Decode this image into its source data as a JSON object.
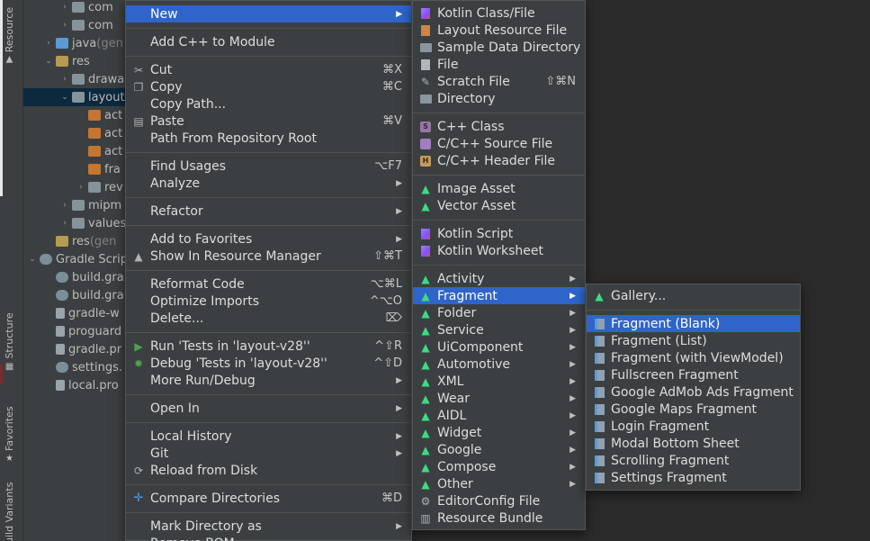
{
  "tool_stripe": {
    "resource_tab": "Resource",
    "structure_tab": "Structure",
    "favorites_tab": "Favorites",
    "build_variants_tab": "uild Variants"
  },
  "project_tree": {
    "rows": [
      {
        "indent": 1,
        "arrow": "›",
        "icon": "folder",
        "text": "com",
        "suffix": ""
      },
      {
        "indent": 1,
        "arrow": "›",
        "icon": "folder",
        "text": "com",
        "suffix": ""
      },
      {
        "indent": 0,
        "arrow": "›",
        "icon": "java",
        "text": "java",
        "suffix": " (gen"
      },
      {
        "indent": 0,
        "arrow": "⌄",
        "icon": "res",
        "text": "res",
        "suffix": ""
      },
      {
        "indent": 1,
        "arrow": "›",
        "icon": "folder",
        "text": "drawa",
        "suffix": ""
      },
      {
        "indent": 1,
        "arrow": "⌄",
        "icon": "folder",
        "text": "layout",
        "suffix": "",
        "selected": true
      },
      {
        "indent": 2,
        "arrow": "",
        "icon": "xml",
        "text": "act",
        "suffix": ""
      },
      {
        "indent": 2,
        "arrow": "",
        "icon": "xml",
        "text": "act",
        "suffix": ""
      },
      {
        "indent": 2,
        "arrow": "",
        "icon": "xml",
        "text": "act",
        "suffix": ""
      },
      {
        "indent": 2,
        "arrow": "",
        "icon": "xml",
        "text": "fra",
        "suffix": ""
      },
      {
        "indent": 2,
        "arrow": "›",
        "icon": "folder",
        "text": "rev",
        "suffix": ""
      },
      {
        "indent": 1,
        "arrow": "›",
        "icon": "folder",
        "text": "mipm",
        "suffix": ""
      },
      {
        "indent": 1,
        "arrow": "›",
        "icon": "folder",
        "text": "values",
        "suffix": ""
      },
      {
        "indent": 0,
        "arrow": "",
        "icon": "res",
        "text": "res",
        "suffix": " (gen"
      },
      {
        "indent": -1,
        "arrow": "⌄",
        "icon": "gradle",
        "text": "Gradle Scrip",
        "suffix": ""
      },
      {
        "indent": 0,
        "arrow": "",
        "icon": "gradle",
        "text": "build.gra",
        "suffix": ""
      },
      {
        "indent": 0,
        "arrow": "",
        "icon": "gradle",
        "text": "build.gra",
        "suffix": ""
      },
      {
        "indent": 0,
        "arrow": "",
        "icon": "file",
        "text": "gradle-w",
        "suffix": ""
      },
      {
        "indent": 0,
        "arrow": "",
        "icon": "file",
        "text": "proguard",
        "suffix": ""
      },
      {
        "indent": 0,
        "arrow": "",
        "icon": "file",
        "text": "gradle.pr",
        "suffix": ""
      },
      {
        "indent": 0,
        "arrow": "",
        "icon": "gradle",
        "text": "settings.",
        "suffix": ""
      },
      {
        "indent": 0,
        "arrow": "",
        "icon": "file",
        "text": "local.pro",
        "suffix": ""
      }
    ]
  },
  "main_menu": {
    "items": [
      {
        "label": "New",
        "shortcut": "",
        "submenu": true,
        "active": true,
        "icon": ""
      },
      {
        "sep": true
      },
      {
        "label": "Add C++ to Module",
        "shortcut": "",
        "submenu": false,
        "icon": ""
      },
      {
        "sep": true
      },
      {
        "label": "Cut",
        "shortcut": "⌘X",
        "submenu": false,
        "icon": "scissors"
      },
      {
        "label": "Copy",
        "shortcut": "⌘C",
        "submenu": false,
        "icon": "copy"
      },
      {
        "label": "Copy Path...",
        "shortcut": "",
        "submenu": false,
        "icon": ""
      },
      {
        "label": "Paste",
        "shortcut": "⌘V",
        "submenu": false,
        "icon": "paste"
      },
      {
        "label": "Path From Repository Root",
        "shortcut": "",
        "submenu": false,
        "icon": ""
      },
      {
        "sep": true
      },
      {
        "label": "Find Usages",
        "shortcut": "⌥F7",
        "submenu": false,
        "icon": ""
      },
      {
        "label": "Analyze",
        "shortcut": "",
        "submenu": true,
        "icon": ""
      },
      {
        "sep": true
      },
      {
        "label": "Refactor",
        "shortcut": "",
        "submenu": true,
        "icon": ""
      },
      {
        "sep": true
      },
      {
        "label": "Add to Favorites",
        "shortcut": "",
        "submenu": true,
        "icon": ""
      },
      {
        "label": "Show In Resource Manager",
        "shortcut": "⇧⌘T",
        "submenu": false,
        "icon": "resource-manager"
      },
      {
        "sep": true
      },
      {
        "label": "Reformat Code",
        "shortcut": "⌥⌘L",
        "submenu": false,
        "icon": ""
      },
      {
        "label": "Optimize Imports",
        "shortcut": "^⌥O",
        "submenu": false,
        "icon": ""
      },
      {
        "label": "Delete...",
        "shortcut": "⌦",
        "submenu": false,
        "icon": ""
      },
      {
        "sep": true
      },
      {
        "label": "Run 'Tests in 'layout-v28''",
        "shortcut": "^⇧R",
        "submenu": false,
        "icon": "run"
      },
      {
        "label": "Debug 'Tests in 'layout-v28''",
        "shortcut": "^⇧D",
        "submenu": false,
        "icon": "debug"
      },
      {
        "label": "More Run/Debug",
        "shortcut": "",
        "submenu": true,
        "icon": ""
      },
      {
        "sep": true
      },
      {
        "label": "Open In",
        "shortcut": "",
        "submenu": true,
        "icon": ""
      },
      {
        "sep": true
      },
      {
        "label": "Local History",
        "shortcut": "",
        "submenu": true,
        "icon": ""
      },
      {
        "label": "Git",
        "shortcut": "",
        "submenu": true,
        "icon": ""
      },
      {
        "label": "Reload from Disk",
        "shortcut": "",
        "submenu": false,
        "icon": "reload"
      },
      {
        "sep": true
      },
      {
        "label": "Compare Directories",
        "shortcut": "⌘D",
        "submenu": false,
        "icon": "compare"
      },
      {
        "sep": true
      },
      {
        "label": "Mark Directory as",
        "shortcut": "",
        "submenu": true,
        "icon": ""
      },
      {
        "label": "Remove BOM",
        "shortcut": "",
        "submenu": false,
        "icon": ""
      }
    ]
  },
  "new_menu": {
    "items": [
      {
        "label": "Kotlin Class/File",
        "shortcut": "",
        "submenu": false,
        "icon": "kotlin"
      },
      {
        "label": "Layout Resource File",
        "shortcut": "",
        "submenu": false,
        "icon": "xml"
      },
      {
        "label": "Sample Data Directory",
        "shortcut": "",
        "submenu": false,
        "icon": "folder"
      },
      {
        "label": "File",
        "shortcut": "",
        "submenu": false,
        "icon": "doc"
      },
      {
        "label": "Scratch File",
        "shortcut": "⇧⌘N",
        "submenu": false,
        "icon": "scratch"
      },
      {
        "label": "Directory",
        "shortcut": "",
        "submenu": false,
        "icon": "folder"
      },
      {
        "sep": true
      },
      {
        "label": "C++ Class",
        "shortcut": "",
        "submenu": false,
        "icon": "cpp-s"
      },
      {
        "label": "C/C++ Source File",
        "shortcut": "",
        "submenu": false,
        "icon": "cpp-source"
      },
      {
        "label": "C/C++ Header File",
        "shortcut": "",
        "submenu": false,
        "icon": "cpp-header"
      },
      {
        "sep": true
      },
      {
        "label": "Image Asset",
        "shortcut": "",
        "submenu": false,
        "icon": "android"
      },
      {
        "label": "Vector Asset",
        "shortcut": "",
        "submenu": false,
        "icon": "android"
      },
      {
        "sep": true
      },
      {
        "label": "Kotlin Script",
        "shortcut": "",
        "submenu": false,
        "icon": "kotlin"
      },
      {
        "label": "Kotlin Worksheet",
        "shortcut": "",
        "submenu": false,
        "icon": "kotlin"
      },
      {
        "sep": true
      },
      {
        "label": "Activity",
        "shortcut": "",
        "submenu": true,
        "icon": "android"
      },
      {
        "label": "Fragment",
        "shortcut": "",
        "submenu": true,
        "icon": "android",
        "active": true
      },
      {
        "label": "Folder",
        "shortcut": "",
        "submenu": true,
        "icon": "android"
      },
      {
        "label": "Service",
        "shortcut": "",
        "submenu": true,
        "icon": "android"
      },
      {
        "label": "UiComponent",
        "shortcut": "",
        "submenu": true,
        "icon": "android"
      },
      {
        "label": "Automotive",
        "shortcut": "",
        "submenu": true,
        "icon": "android"
      },
      {
        "label": "XML",
        "shortcut": "",
        "submenu": true,
        "icon": "android"
      },
      {
        "label": "Wear",
        "shortcut": "",
        "submenu": true,
        "icon": "android"
      },
      {
        "label": "AIDL",
        "shortcut": "",
        "submenu": true,
        "icon": "android"
      },
      {
        "label": "Widget",
        "shortcut": "",
        "submenu": true,
        "icon": "android"
      },
      {
        "label": "Google",
        "shortcut": "",
        "submenu": true,
        "icon": "android"
      },
      {
        "label": "Compose",
        "shortcut": "",
        "submenu": true,
        "icon": "android"
      },
      {
        "label": "Other",
        "shortcut": "",
        "submenu": true,
        "icon": "android"
      },
      {
        "label": "EditorConfig File",
        "shortcut": "",
        "submenu": false,
        "icon": "gear"
      },
      {
        "label": "Resource Bundle",
        "shortcut": "",
        "submenu": false,
        "icon": "bundle"
      }
    ]
  },
  "fragment_menu": {
    "items": [
      {
        "label": "Gallery...",
        "icon": "android"
      },
      {
        "sep": true
      },
      {
        "label": "Fragment (Blank)",
        "icon": "fragment",
        "active": true
      },
      {
        "label": "Fragment (List)",
        "icon": "fragment"
      },
      {
        "label": "Fragment (with ViewModel)",
        "icon": "fragment"
      },
      {
        "label": "Fullscreen Fragment",
        "icon": "fragment"
      },
      {
        "label": "Google AdMob Ads Fragment",
        "icon": "fragment"
      },
      {
        "label": "Google Maps Fragment",
        "icon": "fragment"
      },
      {
        "label": "Login Fragment",
        "icon": "fragment"
      },
      {
        "label": "Modal Bottom Sheet",
        "icon": "fragment"
      },
      {
        "label": "Scrolling Fragment",
        "icon": "fragment"
      },
      {
        "label": "Settings Fragment",
        "icon": "fragment"
      }
    ]
  },
  "colors": {
    "menu_bg": "#3c3f41",
    "selection": "#2f65ca",
    "tree_selection": "#0d293e",
    "editor_bg": "#2b2b2b"
  }
}
